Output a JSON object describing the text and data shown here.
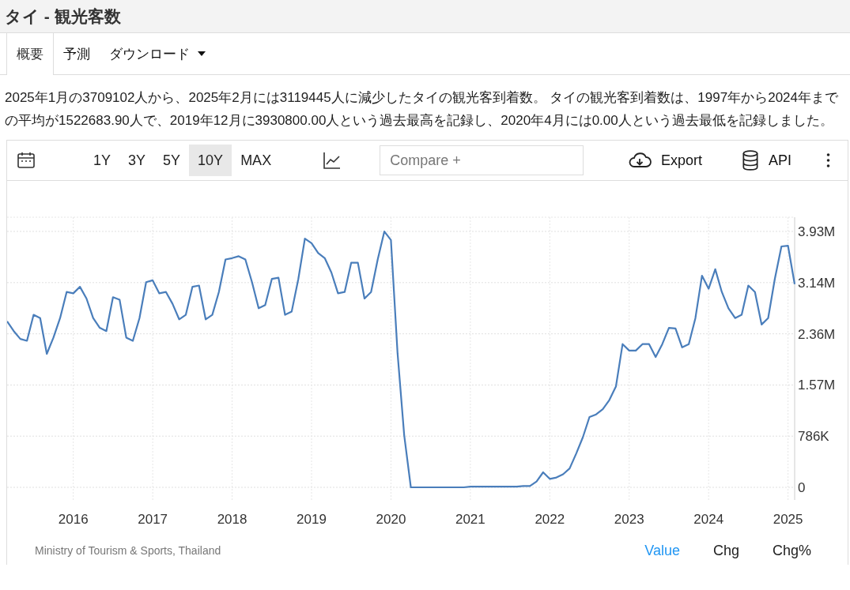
{
  "page_title": "タイ - 観光客数",
  "tabs": [
    {
      "label": "概要",
      "selected": true,
      "dropdown": false
    },
    {
      "label": "予測",
      "selected": false,
      "dropdown": false
    },
    {
      "label": "ダウンロード",
      "selected": false,
      "dropdown": true
    }
  ],
  "summary": "2025年1月の3709102人から、2025年2月には3119445人に減少したタイの観光客到着数。 タイの観光客到着数は、1997年から2024年までの平均が1522683.90人で、2019年12月に3930800.00人という過去最高を記録し、2020年4月には0.00人という過去最低を記録しました。",
  "toolbar": {
    "ranges": [
      {
        "label": "1Y",
        "selected": false
      },
      {
        "label": "3Y",
        "selected": false
      },
      {
        "label": "5Y",
        "selected": false
      },
      {
        "label": "10Y",
        "selected": true
      },
      {
        "label": "MAX",
        "selected": false
      }
    ],
    "compare_placeholder": "Compare +",
    "export_label": "Export",
    "api_label": "API"
  },
  "chart": {
    "chart_data": {
      "type": "line",
      "x": [
        "2015-03",
        "2015-04",
        "2015-05",
        "2015-06",
        "2015-07",
        "2015-08",
        "2015-09",
        "2015-10",
        "2015-11",
        "2015-12",
        "2016-01",
        "2016-02",
        "2016-03",
        "2016-04",
        "2016-05",
        "2016-06",
        "2016-07",
        "2016-08",
        "2016-09",
        "2016-10",
        "2016-11",
        "2016-12",
        "2017-01",
        "2017-02",
        "2017-03",
        "2017-04",
        "2017-05",
        "2017-06",
        "2017-07",
        "2017-08",
        "2017-09",
        "2017-10",
        "2017-11",
        "2017-12",
        "2018-01",
        "2018-02",
        "2018-03",
        "2018-04",
        "2018-05",
        "2018-06",
        "2018-07",
        "2018-08",
        "2018-09",
        "2018-10",
        "2018-11",
        "2018-12",
        "2019-01",
        "2019-02",
        "2019-03",
        "2019-04",
        "2019-05",
        "2019-06",
        "2019-07",
        "2019-08",
        "2019-09",
        "2019-10",
        "2019-11",
        "2019-12",
        "2020-01",
        "2020-02",
        "2020-03",
        "2020-04",
        "2020-05",
        "2020-06",
        "2020-07",
        "2020-08",
        "2020-09",
        "2020-10",
        "2020-11",
        "2020-12",
        "2021-01",
        "2021-02",
        "2021-03",
        "2021-04",
        "2021-05",
        "2021-06",
        "2021-07",
        "2021-08",
        "2021-09",
        "2021-10",
        "2021-11",
        "2021-12",
        "2022-01",
        "2022-02",
        "2022-03",
        "2022-04",
        "2022-05",
        "2022-06",
        "2022-07",
        "2022-08",
        "2022-09",
        "2022-10",
        "2022-11",
        "2022-12",
        "2023-01",
        "2023-02",
        "2023-03",
        "2023-04",
        "2023-05",
        "2023-06",
        "2023-07",
        "2023-08",
        "2023-09",
        "2023-10",
        "2023-11",
        "2023-12",
        "2024-01",
        "2024-02",
        "2024-03",
        "2024-04",
        "2024-05",
        "2024-06",
        "2024-07",
        "2024-08",
        "2024-09",
        "2024-10",
        "2024-11",
        "2024-12",
        "2025-01",
        "2025-02"
      ],
      "series": [
        {
          "color": "#4a7ebb",
          "values": [
            2550000,
            2400000,
            2280000,
            2250000,
            2650000,
            2600000,
            2050000,
            2300000,
            2600000,
            3000000,
            2980000,
            3080000,
            2900000,
            2600000,
            2450000,
            2400000,
            2920000,
            2880000,
            2300000,
            2250000,
            2600000,
            3150000,
            3180000,
            2980000,
            3000000,
            2820000,
            2580000,
            2650000,
            3080000,
            3100000,
            2580000,
            2650000,
            3000000,
            3500000,
            3520000,
            3550000,
            3500000,
            3150000,
            2750000,
            2800000,
            3200000,
            3220000,
            2650000,
            2700000,
            3200000,
            3820000,
            3750000,
            3600000,
            3520000,
            3300000,
            2980000,
            3000000,
            3450000,
            3450000,
            2900000,
            3000000,
            3500000,
            3930000,
            3800000,
            2060000,
            800000,
            0,
            0,
            0,
            0,
            0,
            0,
            0,
            0,
            0,
            10000,
            10000,
            10000,
            10000,
            10000,
            10000,
            10000,
            10000,
            20000,
            20000,
            90000,
            230000,
            130000,
            150000,
            200000,
            290000,
            520000,
            770000,
            1080000,
            1120000,
            1200000,
            1340000,
            1550000,
            2200000,
            2100000,
            2100000,
            2200000,
            2200000,
            2000000,
            2200000,
            2450000,
            2440000,
            2150000,
            2200000,
            2600000,
            3250000,
            3050000,
            3350000,
            3000000,
            2750000,
            2600000,
            2650000,
            3100000,
            3000000,
            2500000,
            2600000,
            3200000,
            3700000,
            3710000,
            3120000
          ]
        }
      ],
      "xlim": [
        "2015-03",
        "2025-02"
      ],
      "ylim": [
        -194000,
        4149000
      ],
      "grid": true,
      "xticks": [
        {
          "value": "2016-01",
          "label": "2016"
        },
        {
          "value": "2017-01",
          "label": "2017"
        },
        {
          "value": "2018-01",
          "label": "2018"
        },
        {
          "value": "2019-01",
          "label": "2019"
        },
        {
          "value": "2020-01",
          "label": "2020"
        },
        {
          "value": "2021-01",
          "label": "2021"
        },
        {
          "value": "2022-01",
          "label": "2022"
        },
        {
          "value": "2023-01",
          "label": "2023"
        },
        {
          "value": "2024-01",
          "label": "2024"
        },
        {
          "value": "2025-01",
          "label": "2025"
        }
      ],
      "yticks": [
        {
          "value": 0,
          "label": "0"
        },
        {
          "value": 786000,
          "label": "786K"
        },
        {
          "value": 1572000,
          "label": "1.57M"
        },
        {
          "value": 2358000,
          "label": "2.36M"
        },
        {
          "value": 3144000,
          "label": "3.14M"
        },
        {
          "value": 3930800,
          "label": "3.93M"
        }
      ]
    }
  },
  "footer": {
    "source": "Ministry of Tourism & Sports, Thailand",
    "modes": [
      {
        "label": "Value",
        "selected": true
      },
      {
        "label": "Chg",
        "selected": false
      },
      {
        "label": "Chg%",
        "selected": false
      }
    ]
  }
}
